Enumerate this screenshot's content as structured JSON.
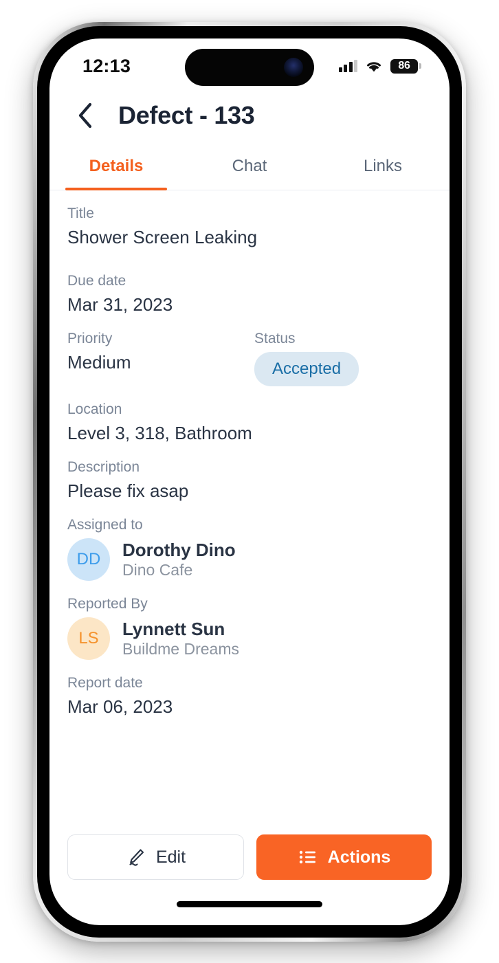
{
  "status_bar": {
    "time": "12:13",
    "signal_icon": "cellular-signal-icon",
    "wifi_icon": "wifi-icon",
    "battery_level": "86"
  },
  "nav": {
    "back_icon": "back-chevron-icon",
    "title": "Defect - 133"
  },
  "tabs": [
    {
      "label": "Details",
      "active": true
    },
    {
      "label": "Chat",
      "active": false
    },
    {
      "label": "Links",
      "active": false
    }
  ],
  "details": {
    "title": {
      "label": "Title",
      "value": "Shower Screen Leaking"
    },
    "due_date": {
      "label": "Due date",
      "value": "Mar 31, 2023"
    },
    "priority": {
      "label": "Priority",
      "value": "Medium"
    },
    "status": {
      "label": "Status",
      "value": "Accepted"
    },
    "location": {
      "label": "Location",
      "value": "Level 3, 318, Bathroom"
    },
    "description": {
      "label": "Description",
      "value": "Please fix asap"
    },
    "assigned_to": {
      "label": "Assigned to",
      "initials": "DD",
      "name": "Dorothy Dino",
      "organization": "Dino Cafe"
    },
    "reported_by": {
      "label": "Reported By",
      "initials": "LS",
      "name": "Lynnett Sun",
      "organization": "Buildme Dreams"
    },
    "report_date": {
      "label": "Report date",
      "value": "Mar 06, 2023"
    }
  },
  "actions_bar": {
    "edit_label": "Edit",
    "edit_icon": "pencil-icon",
    "actions_label": "Actions",
    "actions_icon": "list-icon"
  },
  "colors": {
    "accent_orange": "#f96425",
    "tab_active": "#f4601e",
    "text_primary": "#2a3444",
    "text_label": "#7b8697",
    "status_badge_bg": "#dbe8f2",
    "status_badge_text": "#1a6ea6",
    "avatar_blue_bg": "#cce4f8",
    "avatar_blue_text": "#3d9ceb",
    "avatar_orange_bg": "#fce6c6",
    "avatar_orange_text": "#f5922c"
  }
}
